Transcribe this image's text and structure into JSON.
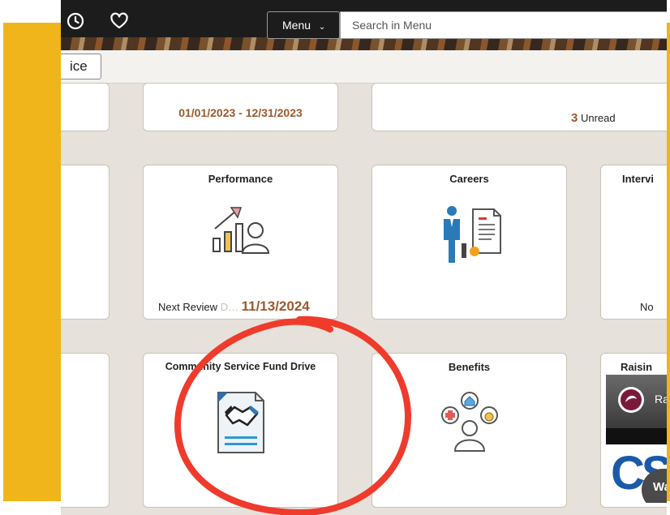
{
  "header": {
    "menu_label": "Menu",
    "search_placeholder": "Search in Menu"
  },
  "page_select": {
    "value": "ice"
  },
  "tiles": {
    "time": {
      "date_range": "01/01/2023 - 12/31/2023"
    },
    "notifications": {
      "count": "3",
      "label": " Unread"
    },
    "performance": {
      "title": "Performance",
      "review_label": "Next Review ",
      "review_partial": "D",
      "review_date": "11/13/2024"
    },
    "careers": {
      "title": "Careers"
    },
    "interviews": {
      "title": "Intervi",
      "footer": "No"
    },
    "fund_drive": {
      "title": "Community Service Fund Drive"
    },
    "benefits": {
      "title": "Benefits"
    },
    "raising": {
      "title": "Raisin",
      "video_text": "Ra",
      "video_logo": "CS",
      "watch_label": "Wa"
    }
  },
  "colors": {
    "accent_brown": "#9b5a2e",
    "annotation_red": "#ef3b2c",
    "frame_yellow": "#efb51a"
  }
}
